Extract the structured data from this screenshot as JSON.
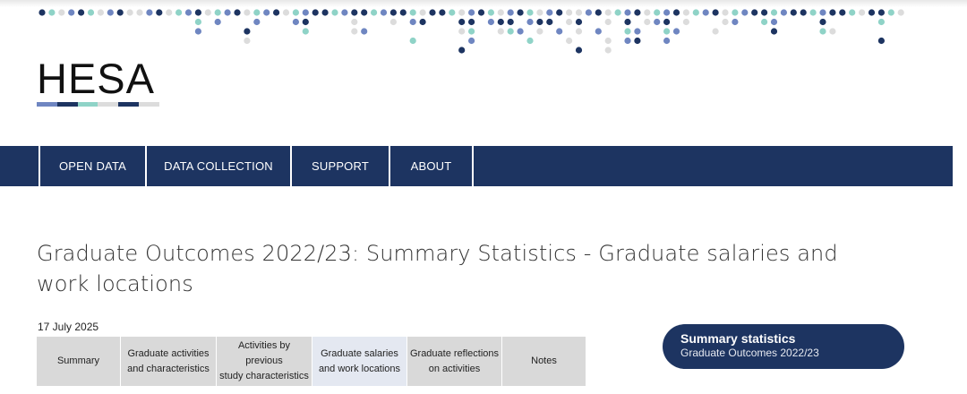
{
  "brand": {
    "logo_text": "HESA",
    "palette": [
      "#1d3461",
      "#6f86c1",
      "#8fd3c7",
      "#dcdcdc",
      "#0f6fa6"
    ]
  },
  "nav": {
    "items": [
      {
        "label": "OPEN DATA"
      },
      {
        "label": "DATA COLLECTION"
      },
      {
        "label": "SUPPORT"
      },
      {
        "label": "ABOUT"
      }
    ]
  },
  "page": {
    "title": "Graduate Outcomes 2022/23: Summary Statistics - Graduate salaries and work locations",
    "date": "17 July 2025"
  },
  "tabs": [
    {
      "line1": "Summary",
      "line2": ""
    },
    {
      "line1": "Graduate activities",
      "line2": "and characteristics"
    },
    {
      "line1": "Activities by previous",
      "line2": "study characteristics"
    },
    {
      "line1": "Graduate salaries",
      "line2": "and work locations",
      "active": true
    },
    {
      "line1": "Graduate reflections",
      "line2": "on activities"
    },
    {
      "line1": "Notes",
      "line2": ""
    }
  ],
  "summary_button": {
    "title": "Summary statistics",
    "subtitle": "Graduate Outcomes 2022/23"
  }
}
